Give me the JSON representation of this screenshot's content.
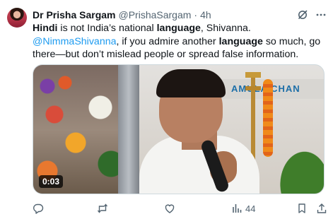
{
  "author": {
    "name": "Dr Prisha Sargam",
    "handle": "@PrishaSargam",
    "separator": "·",
    "time": "4h"
  },
  "tweet": {
    "parts": [
      {
        "text": "Hindi",
        "style": "bold"
      },
      {
        "text": " is not India’s national ",
        "style": "normal"
      },
      {
        "text": "language",
        "style": "bold"
      },
      {
        "text": ", Shivanna. ",
        "style": "normal"
      },
      {
        "text": "@NimmaShivanna",
        "style": "mention"
      },
      {
        "text": ", if you admire another ",
        "style": "normal"
      },
      {
        "text": "language",
        "style": "bold"
      },
      {
        "text": " so much, go there—but don’t mislead people or spread false information.",
        "style": "normal"
      }
    ]
  },
  "media": {
    "type": "video",
    "banner_text": "AMULA CHAN",
    "duration": "0:03"
  },
  "actions": {
    "reply_icon": "reply-icon",
    "retweet_icon": "retweet-icon",
    "like_icon": "heart-icon",
    "views_icon": "views-chart-icon",
    "views_count": "44",
    "bookmark_icon": "bookmark-icon",
    "share_icon": "share-icon"
  },
  "colors": {
    "text": "#0f1419",
    "secondary": "#536471",
    "accent": "#1d9bf0",
    "border": "#cfd9de"
  }
}
